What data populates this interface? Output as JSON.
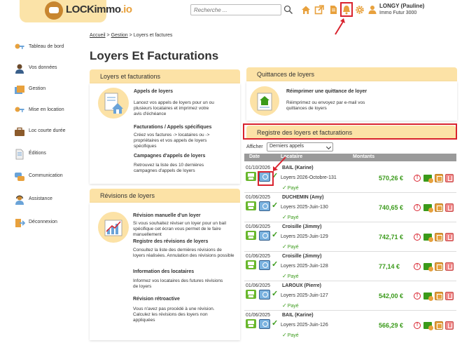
{
  "brand": {
    "name": "LOCKimmo",
    "suffix": ".io"
  },
  "header": {
    "search_placeholder": "Recherche ...",
    "user_name": "LONGY (Pauline)",
    "user_company": "Immo Futur 3000",
    "icons": [
      "search-icon",
      "home-icon",
      "external-link-icon",
      "document-icon",
      "bell-icon",
      "gear-icon",
      "user-icon"
    ]
  },
  "sidebar": {
    "items": [
      {
        "label": "Tableau de bord",
        "icon": "keys-icon"
      },
      {
        "label": "Vos données",
        "icon": "person-icon"
      },
      {
        "label": "Gestion",
        "icon": "folders-icon"
      },
      {
        "label": "Mise en location",
        "icon": "keys-icon"
      },
      {
        "label": "Loc courte durée",
        "icon": "suitcase-icon"
      },
      {
        "label": "Éditions",
        "icon": "document-icon"
      },
      {
        "label": "Communication",
        "icon": "chat-icon"
      },
      {
        "label": "Assistance",
        "icon": "support-icon"
      },
      {
        "label": "Déconnexion",
        "icon": "logout-icon"
      }
    ]
  },
  "breadcrumb": {
    "home": "Accueil",
    "sep": ">",
    "section": "Gestion",
    "current": "Loyers et factures"
  },
  "page_title": "Loyers Et Facturations",
  "panel_loyers": {
    "header": "Loyers et facturations",
    "features": [
      {
        "title": "Appels de loyers",
        "desc": "Lancez vos appels de loyers pour un ou plusieurs locataires et imprimez votre avis d'échéance"
      },
      {
        "title": "Facturations / Appels spécifiques",
        "desc": "Créez vos factures -> locataires ou -> propriétaires et vos appels de loyers spécifiques"
      },
      {
        "title": "Campagnes d'appels de loyers",
        "desc": "Retrouvez la liste des 10 dernières campagnes d'appels de loyers"
      }
    ]
  },
  "panel_revisions": {
    "header": "Révisions de loyers",
    "features": [
      {
        "title": "Révision manuelle d'un loyer",
        "desc": "Si vous souhaitez réviser un loyer pour un bail spécifique cet écran vous permet de le faire manuellement"
      },
      {
        "title": "Registre des révisions de loyers",
        "desc": "Consultez la liste des dernières révisions de loyers réalisées. Annulation des révisions possible"
      },
      {
        "title": "Information des locataires",
        "desc": "Informez vos locataires des futures révisions de loyers"
      },
      {
        "title": "Révision rétroactive",
        "desc": "Vous n'avez pas procédé à une révision. Calculez les révisions des loyers non appliquées"
      }
    ]
  },
  "panel_quittances": {
    "header": "Quittances de loyers",
    "title": "Réimprimer une quittance de loyer",
    "desc": "Réimprimez ou envoyez par e-mail vos quittances de loyers"
  },
  "registre": {
    "header": "Registre des loyers et facturations",
    "filter_label": "Afficher",
    "filter_value": "Derniers appels",
    "columns": [
      "Date",
      "Locataire",
      "Montants"
    ],
    "rows": [
      {
        "date": "01/10/2026",
        "tenant": "BAIL (Karine)",
        "desc": "Loyers 2026-Octobre-131",
        "status": "Payé",
        "amount": "570,26 €"
      },
      {
        "date": "01/06/2025",
        "tenant": "DUCHEMIN (Amy)",
        "desc": "Loyers 2025-Juin-130",
        "status": "Payé",
        "amount": "740,65 €"
      },
      {
        "date": "01/06/2025",
        "tenant": "Croisille (Jimmy)",
        "desc": "Loyers 2025-Juin-129",
        "status": "Payé",
        "amount": "742,71 €"
      },
      {
        "date": "01/06/2025",
        "tenant": "Croisille (Jimmy)",
        "desc": "Loyers 2025-Juin-128",
        "status": "Payé",
        "amount": "77,14 €"
      },
      {
        "date": "01/06/2025",
        "tenant": "LAROUX (Pierre)",
        "desc": "Loyers 2025-Juin-127",
        "status": "Payé",
        "amount": "542,00 €"
      },
      {
        "date": "01/06/2025",
        "tenant": "BAIL (Karine)",
        "desc": "Loyers 2025-Juin-126",
        "status": "Payé",
        "amount": "566,29 €"
      }
    ]
  },
  "colors": {
    "accent": "#fce2a6",
    "highlight": "#d9232e",
    "paid": "#3a9a1a",
    "brand_orange": "#e8a13d"
  }
}
